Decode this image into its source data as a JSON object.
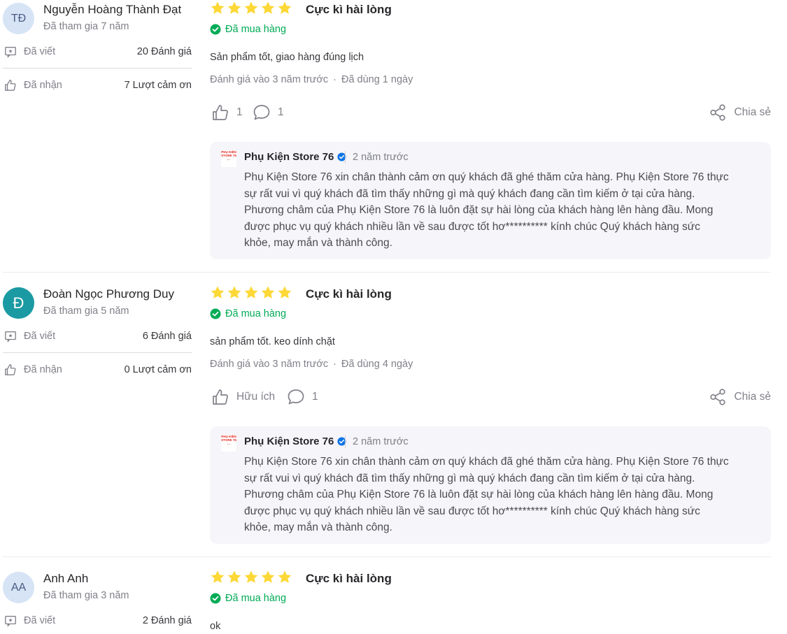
{
  "common": {
    "written_label": "Đã viết",
    "received_label": "Đã nhận",
    "verified_purchase": "Đã mua hàng",
    "share_label": "Chia sẻ",
    "meta_separator": "·",
    "star_color": "#fdd836",
    "verified_color": "#00ab56"
  },
  "reviews": [
    {
      "avatar_initials": "TĐ",
      "name": "Nguyễn Hoàng Thành Đạt",
      "joined": "Đã tham gia 7 năm",
      "written_value": "20 Đánh giá",
      "received_value": "7 Lượt cảm ơn",
      "stars": 5,
      "rating_title": "Cực kì hài lòng",
      "text": "Sản phẩm tốt, giao hàng đúng lịch",
      "reviewed_at": "Đánh giá vào 3 năm trước",
      "used_for": "Đã dùng 1 ngày",
      "like_label": "1",
      "comment_count": "1",
      "reply": {
        "shop_name": "Phụ Kiện Store 76",
        "time": "2 năm trước",
        "lines": [
          "Phụ Kiện Store 76 xin chân thành cảm ơn quý khách đã ghé thăm cửa hàng. Phụ Kiện Store 76 thực",
          "sự rất vui vì quý khách đã tìm thấy những gì mà quý khách đang cần tìm kiếm ở tại cửa hàng.",
          "Phương châm của Phụ Kiện Store 76 là luôn đặt sự hài lòng của khách hàng lên hàng đầu. Mong",
          "được phục vụ quý khách nhiều lần về sau được tốt hơ********** kính chúc Quý khách hàng sức",
          "khỏe, may mắn và thành công."
        ]
      }
    },
    {
      "avatar_initials": "Đ",
      "name": "Đoàn Ngọc Phương Duy",
      "joined": "Đã tham gia 5 năm",
      "written_value": "6 Đánh giá",
      "received_value": "0 Lượt cảm ơn",
      "stars": 5,
      "rating_title": "Cực kì hài lòng",
      "text": "sản phẩm tốt. keo dính chặt",
      "reviewed_at": "Đánh giá vào 3 năm trước",
      "used_for": "Đã dùng 4 ngày",
      "like_label": "Hữu ích",
      "comment_count": "1",
      "reply": {
        "shop_name": "Phụ Kiện Store 76",
        "time": "2 năm trước",
        "lines": [
          "Phụ Kiện Store 76 xin chân thành cảm ơn quý khách đã ghé thăm cửa hàng. Phụ Kiện Store 76 thực",
          "sự rất vui vì quý khách đã tìm thấy những gì mà quý khách đang cần tìm kiếm ở tại cửa hàng.",
          "Phương châm của Phụ Kiện Store 76 là luôn đặt sự hài lòng của khách hàng lên hàng đầu. Mong",
          "được phục vụ quý khách nhiều lần về sau được tốt hơ********** kính chúc Quý khách hàng sức",
          "khỏe, may mắn và thành công."
        ]
      }
    },
    {
      "avatar_initials": "AA",
      "name": "Anh Anh",
      "joined": "Đã tham gia 3 năm",
      "written_value": "2 Đánh giá",
      "stars": 5,
      "rating_title": "Cực kì hài lòng",
      "text": "ok"
    }
  ]
}
